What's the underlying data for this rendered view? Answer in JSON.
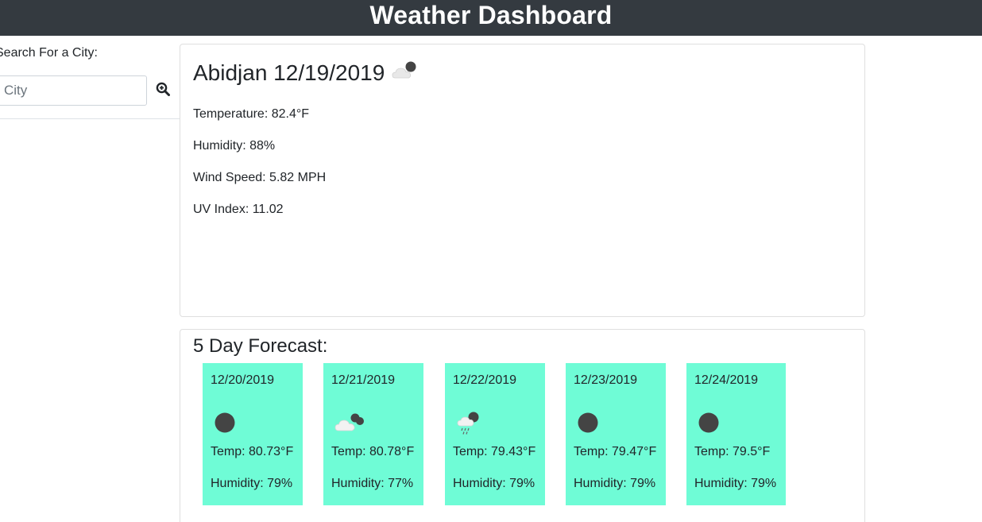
{
  "header": {
    "title": "Weather Dashboard"
  },
  "search": {
    "label": "Search For a City:",
    "placeholder": "City",
    "value": "",
    "button_icon": "search-plus-icon"
  },
  "current": {
    "title": "Abidjan 12/19/2019",
    "icon": "partly-cloudy-night-icon",
    "temperature": "Temperature: 82.4°F",
    "humidity": "Humidity: 88%",
    "wind": "Wind Speed: 5.82 MPH",
    "uv": "UV Index: 11.02"
  },
  "forecast": {
    "title": "5 Day Forecast:",
    "card_color": "#6ffcd6",
    "days": [
      {
        "date": "12/20/2019",
        "icon": "clear-night-icon",
        "temp": "Temp: 80.73°F",
        "humidity": "Humidity: 79%"
      },
      {
        "date": "12/21/2019",
        "icon": "broken-clouds-icon",
        "temp": "Temp: 80.78°F",
        "humidity": "Humidity: 77%"
      },
      {
        "date": "12/22/2019",
        "icon": "rain-night-icon",
        "temp": "Temp: 79.43°F",
        "humidity": "Humidity: 79%"
      },
      {
        "date": "12/23/2019",
        "icon": "clear-night-icon",
        "temp": "Temp: 79.47°F",
        "humidity": "Humidity: 79%"
      },
      {
        "date": "12/24/2019",
        "icon": "clear-night-icon",
        "temp": "Temp: 79.5°F",
        "humidity": "Humidity: 79%"
      }
    ]
  }
}
